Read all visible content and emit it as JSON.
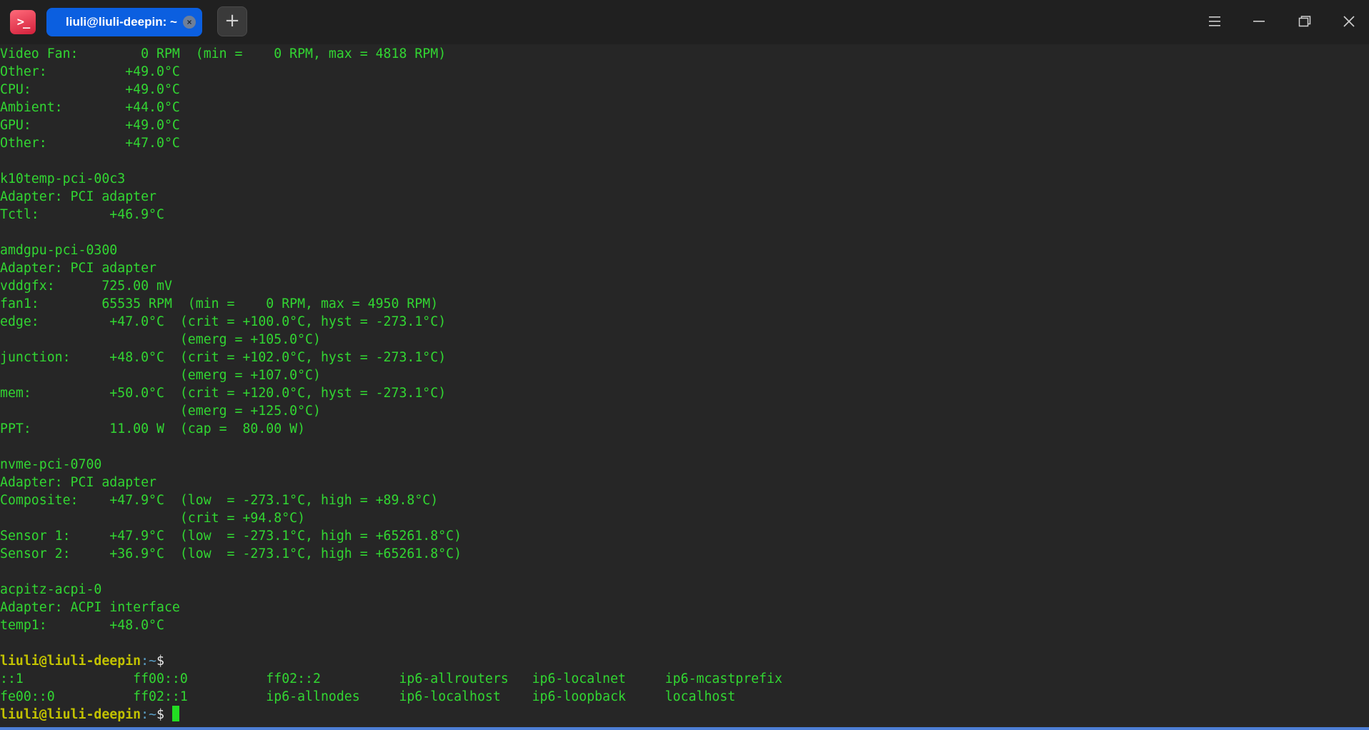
{
  "titlebar": {
    "app_icon_glyph": ">_",
    "tab_title": "liuli@liuli-deepin: ~",
    "tab_close_glyph": "×",
    "new_tab_glyph": "+"
  },
  "colors": {
    "terminal_text": "#32d632",
    "background": "#262626",
    "tab_active": "#0b5fe0",
    "prompt_user": "#c2c200",
    "prompt_path": "#5aa0c8",
    "cursor": "#22dd22"
  },
  "icons": {
    "menu": "hamburger-menu-icon",
    "minimize": "minimize-icon",
    "maximize": "restore-icon",
    "close": "close-icon"
  },
  "terminal": {
    "lines": [
      "Video Fan:        0 RPM  (min =    0 RPM, max = 4818 RPM)",
      "Other:          +49.0°C",
      "CPU:            +49.0°C",
      "Ambient:        +44.0°C",
      "GPU:            +49.0°C",
      "Other:          +47.0°C",
      "",
      "k10temp-pci-00c3",
      "Adapter: PCI adapter",
      "Tctl:         +46.9°C",
      "",
      "amdgpu-pci-0300",
      "Adapter: PCI adapter",
      "vddgfx:      725.00 mV",
      "fan1:        65535 RPM  (min =    0 RPM, max = 4950 RPM)",
      "edge:         +47.0°C  (crit = +100.0°C, hyst = -273.1°C)",
      "                       (emerg = +105.0°C)",
      "junction:     +48.0°C  (crit = +102.0°C, hyst = -273.1°C)",
      "                       (emerg = +107.0°C)",
      "mem:          +50.0°C  (crit = +120.0°C, hyst = -273.1°C)",
      "                       (emerg = +125.0°C)",
      "PPT:          11.00 W  (cap =  80.00 W)",
      "",
      "nvme-pci-0700",
      "Adapter: PCI adapter",
      "Composite:    +47.9°C  (low  = -273.1°C, high = +89.8°C)",
      "                       (crit = +94.8°C)",
      "Sensor 1:     +47.9°C  (low  = -273.1°C, high = +65261.8°C)",
      "Sensor 2:     +36.9°C  (low  = -273.1°C, high = +65261.8°C)",
      "",
      "acpitz-acpi-0",
      "Adapter: ACPI interface",
      "temp1:        +48.0°C",
      ""
    ],
    "prompt1": {
      "user": "liuli@liuli-deepin",
      "path": ":~",
      "symbol": "$"
    },
    "ls_output": [
      "::1              ff00::0          ff02::2          ip6-allrouters   ip6-localnet     ip6-mcastprefix",
      "fe00::0          ff02::1          ip6-allnodes     ip6-localhost    ip6-loopback     localhost"
    ],
    "prompt2": {
      "user": "liuli@liuli-deepin",
      "path": ":~",
      "symbol": "$ "
    }
  }
}
